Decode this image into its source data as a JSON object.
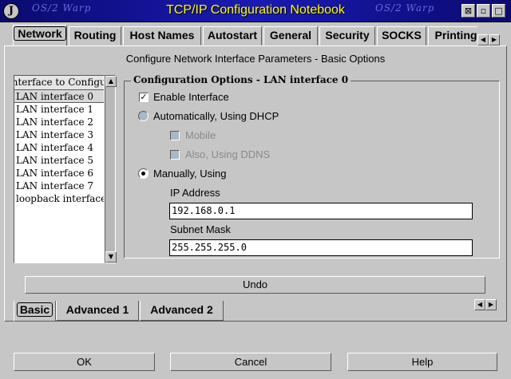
{
  "window": {
    "title": "TCP/IP Configuration Notebook",
    "watermark": "OS/2 Warp",
    "system_menu": "J",
    "controls": [
      "⊠",
      "▫",
      "□"
    ]
  },
  "top_tabs": [
    "Network",
    "Routing",
    "Host Names",
    "Autostart",
    "General",
    "Security",
    "SOCKS",
    "Printing"
  ],
  "active_top_tab": "Network",
  "tab_scroll": {
    "left": "◀",
    "right": "▶"
  },
  "page_heading": "Configure Network Interface Parameters - Basic Options",
  "interface_list": {
    "header": "Interface to Configure",
    "items": [
      "LAN interface 0",
      "LAN interface 1",
      "LAN interface 2",
      "LAN interface 3",
      "LAN interface 4",
      "LAN interface 5",
      "LAN interface 6",
      "LAN interface 7",
      "loopback interface"
    ],
    "selected": "LAN interface 0"
  },
  "group": {
    "title": "Configuration Options - LAN interface 0",
    "enable_label": "Enable Interface",
    "enable_checked": true,
    "dhcp_label": "Automatically, Using DHCP",
    "mobile_label": "Mobile",
    "ddns_label": "Also, Using DDNS",
    "manual_label": "Manually, Using",
    "ip_label": "IP Address",
    "ip_value": "192.168.0.1",
    "mask_label": "Subnet Mask",
    "mask_value": "255.255.255.0"
  },
  "undo_label": "Undo",
  "page_tabs": [
    "Basic",
    "Advanced 1",
    "Advanced 2"
  ],
  "active_page_tab": "Basic",
  "buttons": {
    "ok": "OK",
    "cancel": "Cancel",
    "help": "Help"
  },
  "colors": {
    "titlebar": "#1a1ab4",
    "title_text": "#ffff00",
    "face": "#c6c6c6"
  }
}
